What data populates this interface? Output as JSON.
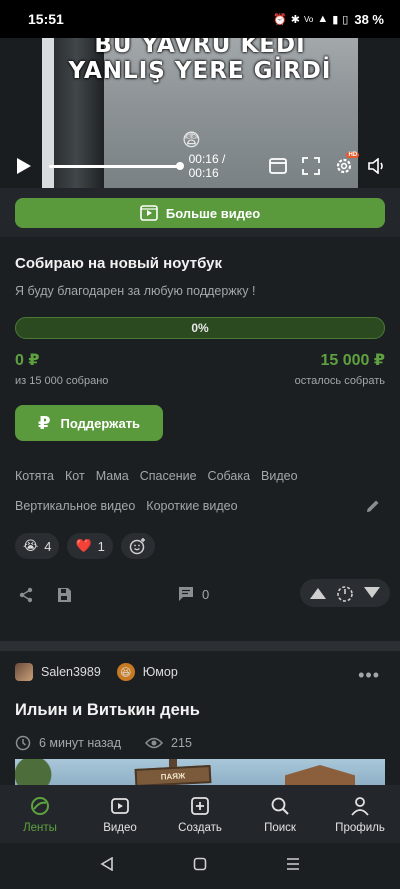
{
  "status_bar": {
    "time": "15:51",
    "battery": "38 %",
    "icons": [
      "alarm-icon",
      "bluetooth-icon",
      "volte-icon",
      "signal-4g-icon",
      "signal-icon",
      "battery-icon"
    ]
  },
  "video": {
    "caption_line1": "BU YAVRU KEDİ",
    "caption_line2": "YANLIŞ YERE GİRDİ",
    "emoji": "😨",
    "time": "00:16 / 00:16",
    "progress": 1.0,
    "hd_badge": "HD"
  },
  "more_video_button": "Больше видео",
  "fundraiser": {
    "title": "Собираю на новый ноутбук",
    "subtitle": "Я буду благодарен за любую поддержку !",
    "progress_label": "0%",
    "progress": 0,
    "collected": "0 ₽",
    "goal": "15 000 ₽",
    "collected_caption": "из 15 000 собрано",
    "remaining_caption": "осталось собрать",
    "support_button": "Поддержать"
  },
  "tags": {
    "row1": [
      "Котята",
      "Кот",
      "Мама",
      "Спасение",
      "Собака",
      "Видео"
    ],
    "row2": [
      "Вертикальное видео",
      "Короткие видео"
    ]
  },
  "reactions": [
    {
      "emoji": "😭",
      "count": "4"
    },
    {
      "emoji": "❤️",
      "count": "1"
    }
  ],
  "actions": {
    "comments_count": "0"
  },
  "next_post": {
    "author": "Salen3989",
    "community": "Юмор",
    "community_emoji": "😆",
    "title": "Ильин и Витькин день",
    "time": "6 минут назад",
    "views": "215",
    "image_sign": "ПАЯЖ"
  },
  "bottom_nav": [
    {
      "label": "Ленты",
      "icon": "feeds-icon",
      "active": true
    },
    {
      "label": "Видео",
      "icon": "video-icon",
      "active": false
    },
    {
      "label": "Создать",
      "icon": "create-icon",
      "active": false
    },
    {
      "label": "Поиск",
      "icon": "search-icon",
      "active": false
    },
    {
      "label": "Профиль",
      "icon": "profile-icon",
      "active": false
    }
  ],
  "colors": {
    "accent": "#5a9a3c",
    "accent_text": "#5ea13f",
    "background": "#1c1f22",
    "surface": "#23272b"
  }
}
